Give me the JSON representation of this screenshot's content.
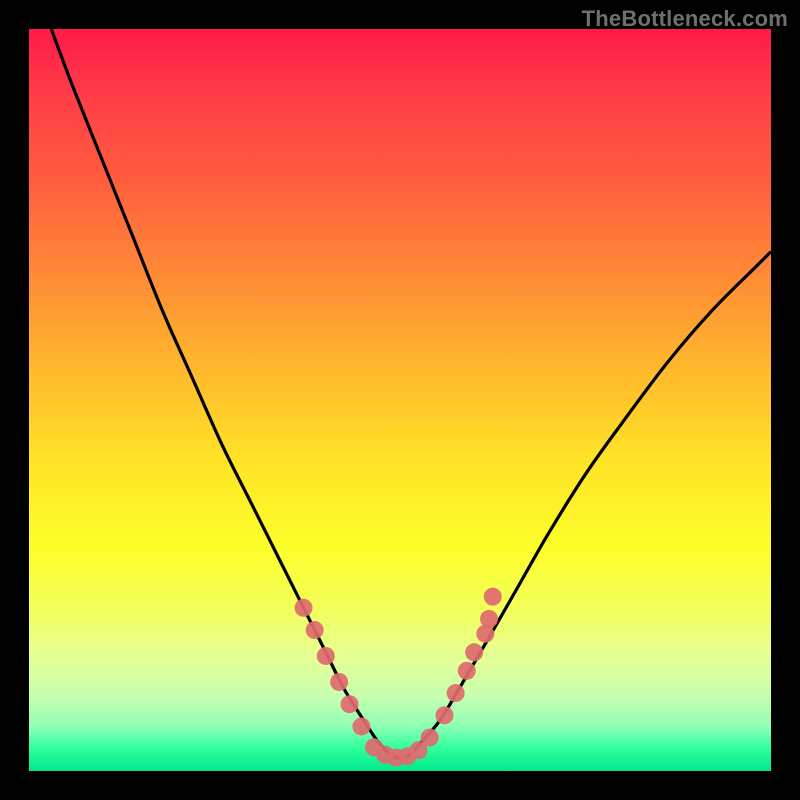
{
  "watermark": "TheBottleneck.com",
  "colors": {
    "frame_bg": "#000000",
    "curve_stroke": "#000000",
    "marker_fill": "#e06a6f",
    "gradient_top": "#ff1a47",
    "gradient_bottom": "#00e88a"
  },
  "chart_data": {
    "type": "line",
    "title": "",
    "xlabel": "",
    "ylabel": "",
    "xlim": [
      0,
      100
    ],
    "ylim": [
      0,
      100
    ],
    "grid": false,
    "legend": false,
    "series": [
      {
        "name": "bottleneck-curve",
        "x": [
          3,
          6,
          10,
          14,
          18,
          22,
          26,
          30,
          34,
          37,
          40,
          42.5,
          45,
          47,
          49,
          51,
          53,
          55.5,
          58.5,
          62,
          66,
          70,
          75,
          80,
          86,
          92,
          98,
          100
        ],
        "y": [
          100,
          92,
          82,
          72,
          62,
          53,
          44,
          36,
          28,
          22,
          16,
          11,
          7,
          4,
          2,
          2,
          4,
          7,
          12,
          18,
          25,
          32,
          40,
          47,
          55,
          62,
          68,
          70
        ]
      }
    ],
    "markers": [
      {
        "name": "left-cluster-1",
        "x": 37.0,
        "y": 22.0
      },
      {
        "name": "left-cluster-2",
        "x": 38.5,
        "y": 19.0
      },
      {
        "name": "left-cluster-3",
        "x": 40.0,
        "y": 15.5
      },
      {
        "name": "left-cluster-4",
        "x": 41.8,
        "y": 12.0
      },
      {
        "name": "left-cluster-5",
        "x": 43.2,
        "y": 9.0
      },
      {
        "name": "left-cluster-6",
        "x": 44.8,
        "y": 6.0
      },
      {
        "name": "bottom-1",
        "x": 46.5,
        "y": 3.2
      },
      {
        "name": "bottom-2",
        "x": 48.0,
        "y": 2.2
      },
      {
        "name": "bottom-3",
        "x": 49.5,
        "y": 1.8
      },
      {
        "name": "bottom-4",
        "x": 51.0,
        "y": 2.0
      },
      {
        "name": "bottom-5",
        "x": 52.5,
        "y": 2.8
      },
      {
        "name": "bottom-6",
        "x": 54.0,
        "y": 4.5
      },
      {
        "name": "right-cluster-1",
        "x": 56.0,
        "y": 7.5
      },
      {
        "name": "right-cluster-2",
        "x": 57.5,
        "y": 10.5
      },
      {
        "name": "right-cluster-3",
        "x": 59.0,
        "y": 13.5
      },
      {
        "name": "right-cluster-4",
        "x": 60.0,
        "y": 16.0
      },
      {
        "name": "right-cluster-5",
        "x": 61.5,
        "y": 18.5
      },
      {
        "name": "right-cluster-6",
        "x": 62.0,
        "y": 20.5
      },
      {
        "name": "right-cluster-7",
        "x": 62.5,
        "y": 23.5
      }
    ]
  }
}
